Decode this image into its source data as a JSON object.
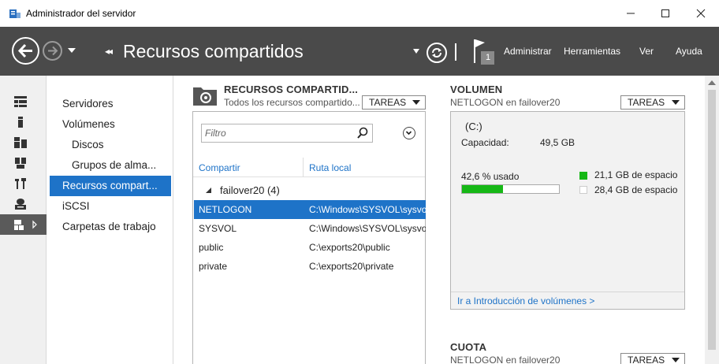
{
  "window": {
    "title": "Administrador del servidor",
    "minimize_icon": "minimize-icon",
    "maximize_icon": "maximize-icon",
    "close_icon": "close-icon"
  },
  "header": {
    "breadcrumb_arrows": "◂◂",
    "title": "Recursos compartidos",
    "notification_count": "1",
    "menu": [
      "Administrar",
      "Herramientas",
      "Ver",
      "Ayuda"
    ]
  },
  "rail": {
    "icons": [
      "dashboard-icon",
      "local-server-icon",
      "all-servers-icon",
      "file-services-icon",
      "tools-icon",
      "storage-icon",
      "file-storage-icon"
    ]
  },
  "nav": {
    "items": [
      {
        "label": "Servidores"
      },
      {
        "label": "Volúmenes"
      },
      {
        "label": "Discos"
      },
      {
        "label": "Grupos de alma..."
      },
      {
        "label": "Recursos compart..."
      },
      {
        "label": "iSCSI"
      },
      {
        "label": "Carpetas de trabajo"
      }
    ]
  },
  "shares": {
    "title": "RECURSOS COMPARTID...",
    "subtitle": "Todos los recursos compartido...",
    "tasks_label": "TAREAS",
    "filter_placeholder": "Filtro",
    "columns": [
      "Compartir",
      "Ruta local"
    ],
    "group": "failover20 (4)",
    "rows": [
      {
        "share": "NETLOGON",
        "path": "C:\\Windows\\SYSVOL\\sysvol\\",
        "selected": true
      },
      {
        "share": "SYSVOL",
        "path": "C:\\Windows\\SYSVOL\\sysvol",
        "selected": false
      },
      {
        "share": "public",
        "path": "C:\\exports20\\public",
        "selected": false
      },
      {
        "share": "private",
        "path": "C:\\exports20\\private",
        "selected": false
      }
    ]
  },
  "volume": {
    "title": "VOLUMEN",
    "subtitle": "NETLOGON en failover20",
    "tasks_label": "TAREAS",
    "drive": "(C:)",
    "capacity_label": "Capacidad:",
    "capacity_value": "49,5 GB",
    "used_label": "42,6 % usado",
    "used_fraction": 0.426,
    "legend_used": "21,1 GB de espacio",
    "legend_free": "28,4 GB de espacio",
    "used_color": "#16b816",
    "link": "Ir a Introducción de volúmenes >"
  },
  "quota": {
    "title": "CUOTA",
    "subtitle": "NETLOGON en failover20",
    "tasks_label": "TAREAS"
  },
  "colors": {
    "header_bg": "#4a4a4a",
    "accent": "#1e73c8"
  }
}
